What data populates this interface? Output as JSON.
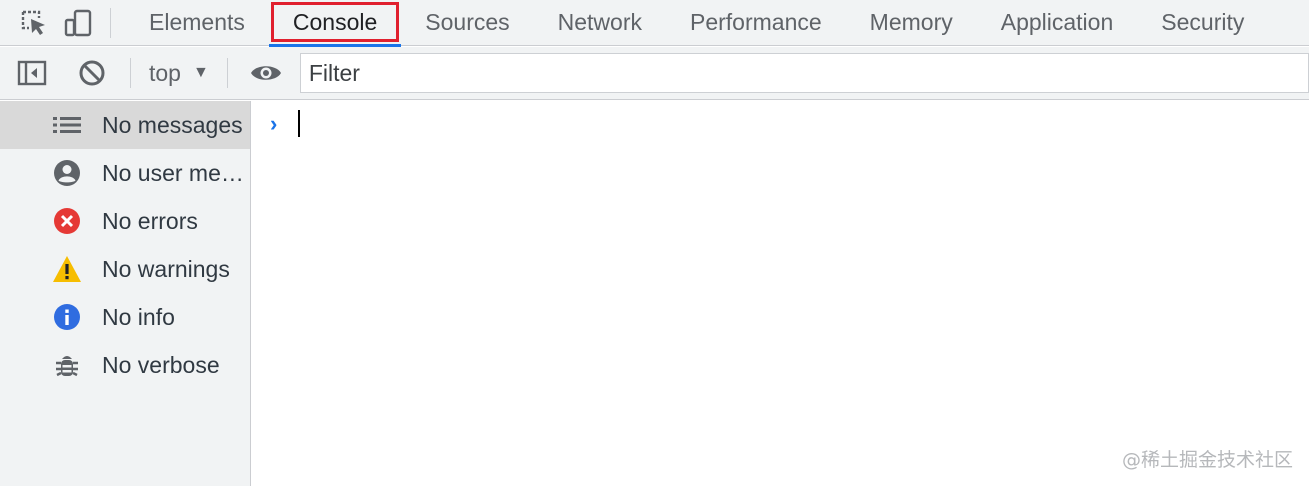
{
  "tabbar": {
    "tabs": [
      {
        "label": "Elements"
      },
      {
        "label": "Console"
      },
      {
        "label": "Sources"
      },
      {
        "label": "Network"
      },
      {
        "label": "Performance"
      },
      {
        "label": "Memory"
      },
      {
        "label": "Application"
      },
      {
        "label": "Security"
      }
    ],
    "active_tab": "Console"
  },
  "toolbar": {
    "context": "top",
    "filter_placeholder": "Filter"
  },
  "sidebar": {
    "items": [
      {
        "label": "No messages",
        "icon": "list-icon"
      },
      {
        "label": "No user messages",
        "icon": "user-icon"
      },
      {
        "label": "No errors",
        "icon": "error-icon"
      },
      {
        "label": "No warnings",
        "icon": "warning-icon"
      },
      {
        "label": "No info",
        "icon": "info-icon"
      },
      {
        "label": "No verbose",
        "icon": "bug-icon"
      }
    ]
  },
  "console": {
    "prompt": "›"
  },
  "watermark": "@稀土掘金技术社区",
  "colors": {
    "accent": "#1a73e8",
    "highlight_box": "#e0202e",
    "error": "#e53935",
    "warning": "#f6bd00",
    "info": "#2f6ce0"
  }
}
